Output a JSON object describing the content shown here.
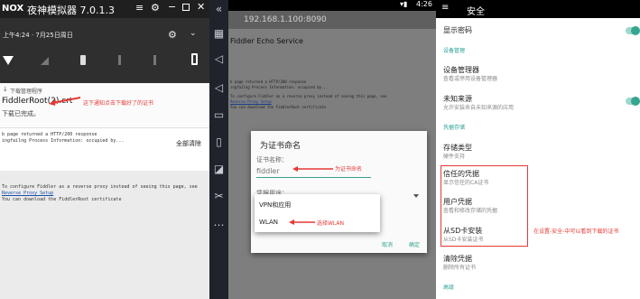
{
  "left": {
    "logo": "NOX",
    "app_title": "夜神模拟器 7.0.1.3",
    "shade_datetime": "上午4:24 · 7月25日周日",
    "notification": {
      "app": "下载管理程序",
      "title": "FiddlerRoot(2).crt",
      "status": "下载已完成。"
    },
    "annotation": "这下通知点击下载好了的证书",
    "clear_all": "全部清除",
    "page_lines": [
      "b page returned a HTTP/200 response",
      "ingfailng Process Information: occupied by...",
      "To configure Fiddler as a reverse proxy instead of seeing this page, see",
      "Reverse Proxy Setup",
      "You can download the FiddlerRoot certificate"
    ]
  },
  "right_browser": {
    "status_time": "4:26",
    "url": "192.168.1.100:8090",
    "page_title": "Fiddler Echo Service",
    "page_lines": [
      "b page returned a HTTP/200 response",
      "ingfailng Process Information: occupied by...",
      "To configure Fiddler as a reverse proxy instead of seeing this page, see",
      "Reverse Proxy Setup",
      "You can download the FiddlerRoot certificate"
    ],
    "dialog": {
      "title": "为证书命名",
      "name_label": "证书名称：",
      "name_value": "fiddler",
      "name_annotation": "为证书命名",
      "usage_label": "凭据用途：",
      "options": [
        "VPN和应用",
        "WLAN"
      ],
      "usage_annotation": "选择WLAN",
      "cancel": "取消",
      "ok": "确定"
    }
  },
  "settings": {
    "title": "安全",
    "items": [
      {
        "title": "显示密码",
        "toggle": true
      },
      {
        "section": "设备管理"
      },
      {
        "title": "设备管理器",
        "sub": "查看或停用设备管理器"
      },
      {
        "title": "未知来源",
        "sub": "允许安装来自未知来源的应用",
        "toggle": true
      },
      {
        "section": "凭据存储"
      },
      {
        "title": "存储类型",
        "sub": "硬件支持"
      },
      {
        "title": "信任的凭据",
        "sub": "显示信任的CA证书"
      },
      {
        "title": "用户凭据",
        "sub": "查看和修改存储的凭据"
      },
      {
        "title": "从SD卡安装",
        "sub": "从SD卡安装证书"
      },
      {
        "title": "清除凭据",
        "sub": "删除所有证书"
      },
      {
        "section": "高级"
      }
    ],
    "annotation": "在设置-安全-中可以看到下载的证书"
  },
  "sidebar_icons": [
    "collapse-icon",
    "keyboard-icon",
    "volume-up-icon",
    "volume-down-icon",
    "screen-icon",
    "apk-install-icon",
    "more-tools-icon",
    "cut-icon",
    "more-icon"
  ],
  "colors": {
    "teal": "#35a58f",
    "annotation_red": "#e53935"
  }
}
